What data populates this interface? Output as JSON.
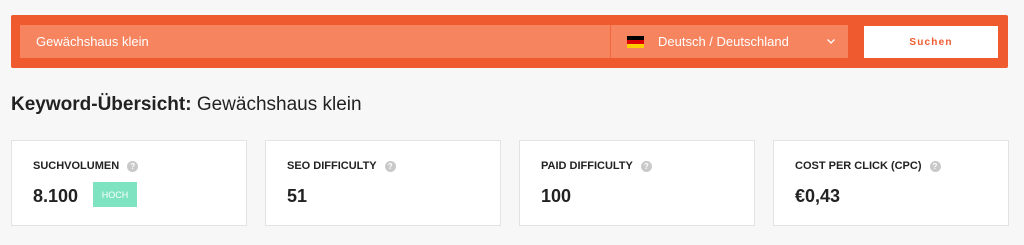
{
  "search": {
    "value": "Gewächshaus klein",
    "placeholder": "Gewächshaus klein",
    "language": "Deutsch / Deutschland",
    "button_label": "Suchen"
  },
  "overview": {
    "label": "Keyword-Übersicht:",
    "keyword": "Gewächshaus klein"
  },
  "metrics": [
    {
      "label": "SUCHVOLUMEN",
      "value": "8.100",
      "badge": "HOCH"
    },
    {
      "label": "SEO DIFFICULTY",
      "value": "51"
    },
    {
      "label": "PAID DIFFICULTY",
      "value": "100"
    },
    {
      "label": "COST PER CLICK (CPC)",
      "value": "€0,43"
    }
  ],
  "colors": {
    "brand": "#f05a2f",
    "input_bg": "#f5845f",
    "badge_high": "#7de3c0"
  },
  "icons": {
    "flag": "germany-flag-icon",
    "dropdown": "chevron-down-icon",
    "help": "question-mark-icon"
  }
}
